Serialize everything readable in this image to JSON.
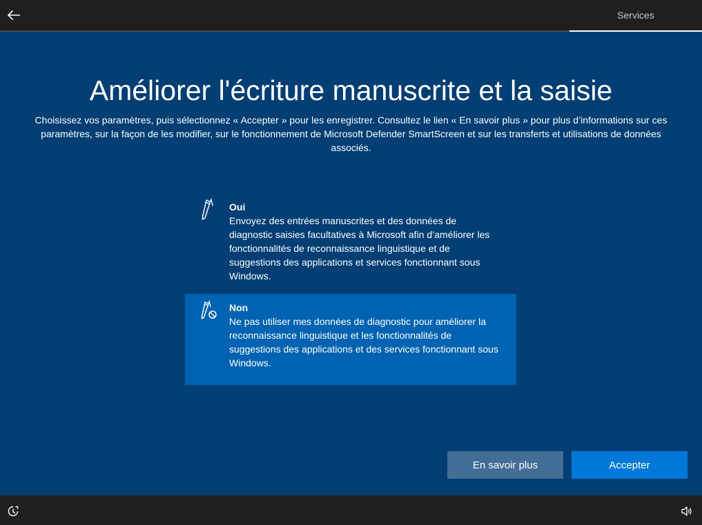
{
  "header": {
    "tab_label": "Services"
  },
  "page": {
    "title": "Améliorer l'écriture manuscrite et la saisie",
    "subtitle": "Choisissez vos paramètres, puis sélectionnez « Accepter » pour les enregistrer. Consultez le lien « En savoir plus » pour plus d’informations sur ces paramètres, sur la façon de les modifier, sur le fonctionnement de Microsoft Defender SmartScreen et sur les transferts et utilisations de données associés."
  },
  "options": [
    {
      "icon": "pen-icon",
      "title": "Oui",
      "description": "Envoyez des entrées manuscrites et des données de diagnostic saisies facultatives à Microsoft afin d’améliorer les fonctionnalités de reconnaissance linguistique et de suggestions des applications et services fonctionnant sous Windows.",
      "selected": false
    },
    {
      "icon": "pen-blocked-icon",
      "title": "Non",
      "description": "Ne pas utiliser mes données de diagnostic pour améliorer la reconnaissance linguistique et les fonctionnalités de suggestions des applications et des services fonctionnant sous Windows.",
      "selected": true
    }
  ],
  "buttons": {
    "learn_more": "En savoir plus",
    "accept": "Accepter"
  },
  "colors": {
    "background": "#003e74",
    "bar": "#1f1f1f",
    "selected_option": "#0063b1",
    "accept_button": "#0078d7",
    "learn_more_button": "#426d96"
  }
}
